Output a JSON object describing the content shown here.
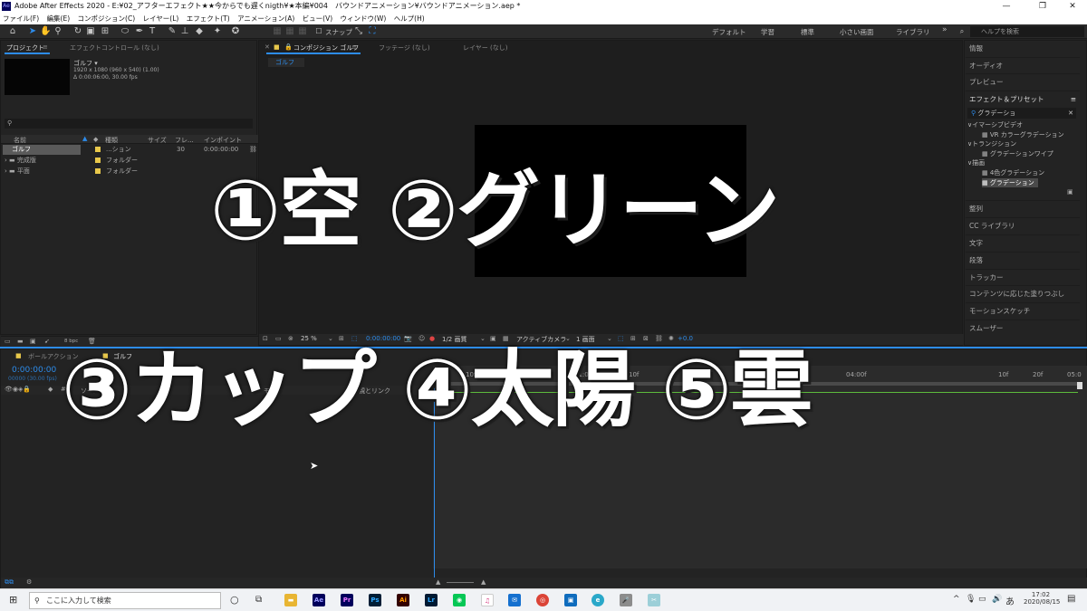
{
  "window": {
    "title": "Adobe After Effects 2020 - E:¥02_アフターエフェクト★★今からでも遅くnigth¥★本編¥004　バウンドアニメーション¥バウンドアニメーション.aep *",
    "logo": "Ae"
  },
  "menu": [
    "ファイル(F)",
    "編集(E)",
    "コンポジション(C)",
    "レイヤー(L)",
    "エフェクト(T)",
    "アニメーション(A)",
    "ビュー(V)",
    "ウィンドウ(W)",
    "ヘルプ(H)"
  ],
  "toolbar": {
    "snap_label": "スナップ",
    "workspaces": [
      "デフォルト",
      "学習",
      "標準",
      "小さい画面",
      "ライブラリ"
    ],
    "more": "»",
    "help_search_placeholder": "ヘルプを検索"
  },
  "project_panel": {
    "tab_project": "プロジェクト",
    "tab_effect_controls": "エフェクトコントロール (なし)",
    "selected_name": "ゴルフ ▾",
    "selected_info1": "1920 x 1080 (960 x 540) (1.00)",
    "selected_info2": "Δ 0:00:06:00, 30.00 fps",
    "columns": [
      "名前",
      "種類",
      "サイズ",
      "フレ...",
      "インポイント"
    ],
    "items": [
      {
        "name": "ゴルフ",
        "type": "...ション",
        "frame": "30",
        "in": "0:00:00:00"
      },
      {
        "name": "完成版",
        "type": "フォルダー",
        "frame": "",
        "in": ""
      },
      {
        "name": "平面",
        "type": "フォルダー",
        "frame": "",
        "in": ""
      }
    ],
    "bpc": "8 bpc"
  },
  "comp_panel": {
    "tab_comp": "コンポジション ゴルフ",
    "tab_footage": "フッテージ (なし)",
    "tab_layer": "レイヤー (なし)",
    "flow_tab": "ゴルフ",
    "zoom": "25 %",
    "timecode": "0:00:00:00",
    "resolution": "1/2 画質",
    "camera": "アクティブカメラ",
    "views": "1 画面",
    "exposure": "+0.0"
  },
  "right_panel": {
    "top_items": [
      "情報",
      "オーディオ",
      "プレビュー"
    ],
    "effects_title": "エフェクト＆プリセット",
    "search_value": "グラデーショ",
    "tree": [
      "∨イマーシブビデオ",
      "VR カラーグラデーション",
      "∨トランジション",
      "グラデーションワイプ",
      "∨描画",
      "4色グラデーション",
      "グラデーション"
    ],
    "bottom_items": [
      "整列",
      "CC ライブラリ",
      "文字",
      "段落",
      "トラッカー",
      "コンテンツに応じた塗りつぶし",
      "モーションスケッチ",
      "スムーザー"
    ]
  },
  "timeline": {
    "tab_render": "ボールアクション",
    "tab_comp": "ゴルフ",
    "timecode": "0:00:00:00",
    "frame_info": "00000 (30.00 fps)",
    "source_col": "ソース",
    "mode_col": "モード",
    "parent_col": "親とリンク",
    "ruler": [
      "10f",
      "20f",
      "01:00f",
      "10f",
      "20f",
      "04:00f",
      "10f",
      "20f",
      "05:0"
    ]
  },
  "overlay": {
    "line1": "①空 ②グリーン",
    "line2": "③カップ ④太陽 ⑤雲"
  },
  "taskbar": {
    "search_placeholder": "ここに入力して検索",
    "time": "17:02",
    "date": "2020/08/15",
    "ime": "あ",
    "apps": [
      {
        "label": "Ae",
        "color": "#00005b"
      },
      {
        "label": "Pr",
        "color": "#00005b"
      },
      {
        "label": "Ps",
        "color": "#001e36"
      },
      {
        "label": "Ai",
        "color": "#330000"
      },
      {
        "label": "Lr",
        "color": "#001a33"
      }
    ]
  },
  "colors": {
    "accent": "#2d8ceb",
    "folder": "#e8c84b",
    "timecode": "#2d8ceb"
  }
}
